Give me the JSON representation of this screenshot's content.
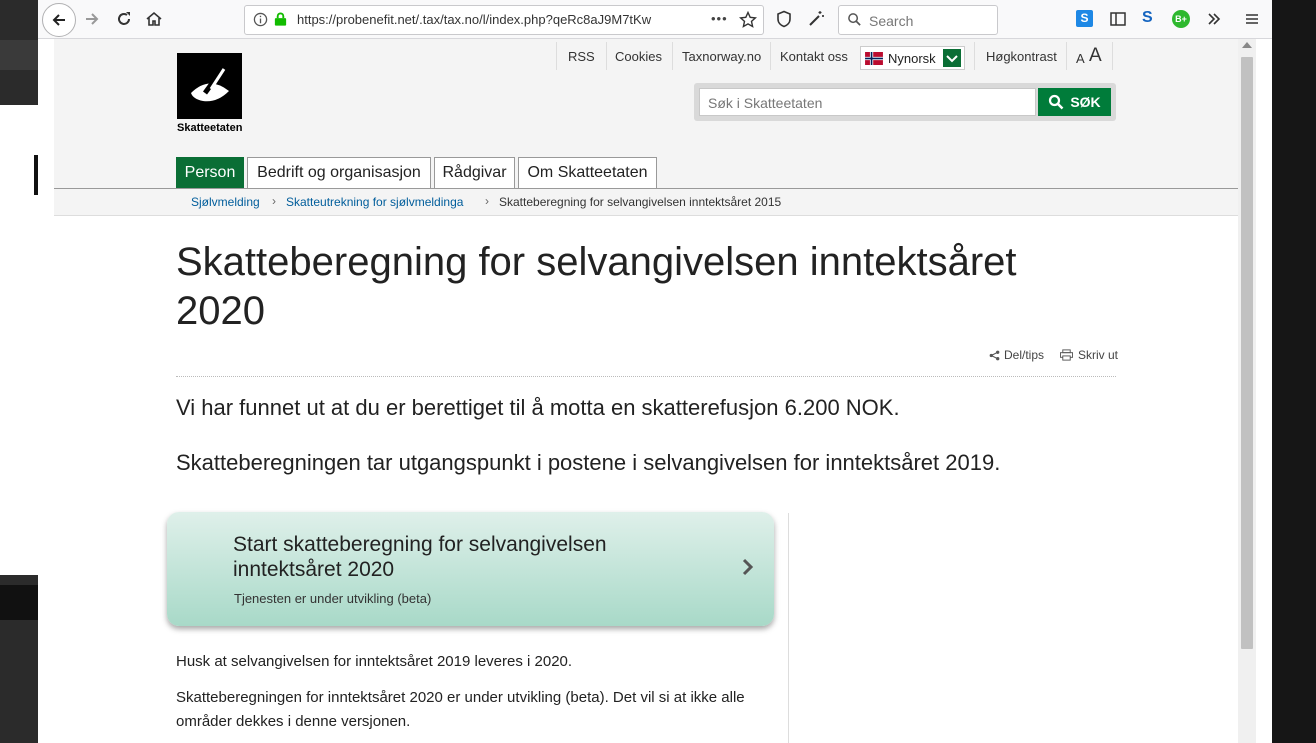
{
  "browser": {
    "url": "https://probenefit.net/.tax/tax.no/l/index.php?qeRc8aJ9M7tKw",
    "search_placeholder": "Search",
    "more_dots": "•••"
  },
  "top_links": {
    "rss": "RSS",
    "cookies": "Cookies",
    "taxnorway": "Taxnorway.no",
    "contact": "Kontakt oss",
    "language": "Nynorsk",
    "contrast": "Høgkontrast",
    "font_small": "A",
    "font_large": "A"
  },
  "logo": {
    "name": "Skatteetaten"
  },
  "site_search": {
    "placeholder": "Søk i Skatteetaten",
    "button": "SØK"
  },
  "nav": {
    "tabs": [
      {
        "label": "Person"
      },
      {
        "label": "Bedrift og organisasjon"
      },
      {
        "label": "Rådgivar"
      },
      {
        "label": "Om Skatteetaten"
      }
    ]
  },
  "breadcrumb": {
    "items": [
      "Sjølvmelding",
      "Skatteutrekning for sjølvmeldinga",
      "Skatteberegning for selvangivelsen inntektsåret 2015"
    ]
  },
  "main": {
    "title": "Skatteberegning for selvangivelsen inntektsåret 2020",
    "share": "Del/tips",
    "print": "Skriv ut",
    "refund": "Vi har funnet ut at du er berettiget til å motta en skatterefusjon 6.200 NOK.",
    "basis": "Skatteberegningen tar utgangspunkt i postene i selvangivelsen for inntektsåret 2019.",
    "start_card": {
      "title": "Start skatteberegning for selvangivelsen inntektsåret 2020",
      "subtitle": "Tjenesten er under utvikling (beta)"
    },
    "note1": "Husk at selvangivelsen for inntektsåret 2019 leveres i 2020.",
    "note2": "Skatteberegningen for inntektsåret 2020 er under utvikling (beta). Det vil si at ikke alle områder dekkes i denne versjonen."
  },
  "colors": {
    "brand_green": "#0a6e35",
    "link_blue": "#005d9b"
  }
}
